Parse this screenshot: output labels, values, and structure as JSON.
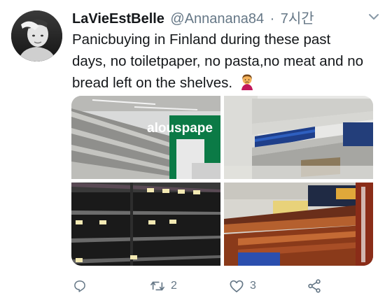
{
  "tweet": {
    "display_name": "LaVieEstBelle",
    "handle": "@Annanana84",
    "separator": "·",
    "time": "7시간",
    "text": "Panicbuying in Finland during these past days, no toiletpaper, no pasta,no meat and no bread left on the shelves.",
    "emoji_icon": "woman-frowning-emoji-icon"
  },
  "media": {
    "photo1_sign_text": "alouspape"
  },
  "actions": {
    "reply_count": "",
    "retweet_count": "2",
    "like_count": "3"
  },
  "colors": {
    "secondary_text": "#657786",
    "primary_text": "#14171a",
    "shelf_sign_green": "#0a8a4e"
  }
}
